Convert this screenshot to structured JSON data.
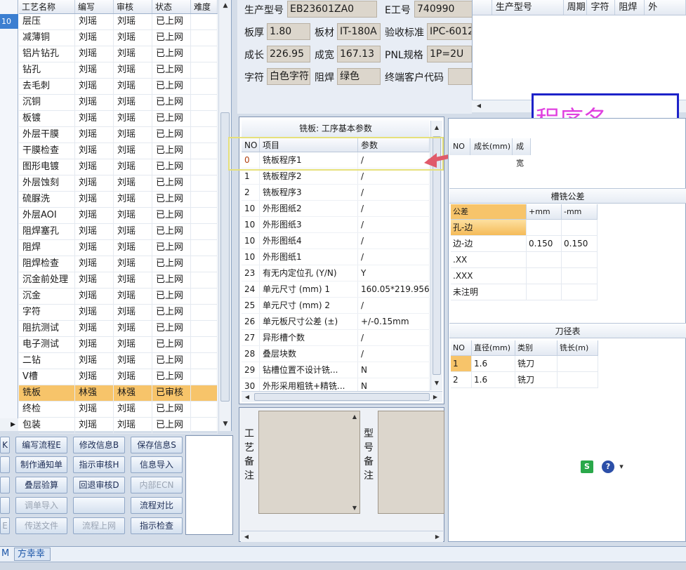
{
  "process_grid": {
    "selected_row_marker": "10",
    "headers": [
      "工艺名称",
      "编写",
      "审核",
      "状态",
      "难度"
    ],
    "rows": [
      [
        "层压",
        "刘瑶",
        "刘瑶",
        "已上网",
        ""
      ],
      [
        "减薄铜",
        "刘瑶",
        "刘瑶",
        "已上网",
        ""
      ],
      [
        "铝片钻孔",
        "刘瑶",
        "刘瑶",
        "已上网",
        ""
      ],
      [
        "钻孔",
        "刘瑶",
        "刘瑶",
        "已上网",
        ""
      ],
      [
        "去毛刺",
        "刘瑶",
        "刘瑶",
        "已上网",
        ""
      ],
      [
        "沉铜",
        "刘瑶",
        "刘瑶",
        "已上网",
        ""
      ],
      [
        "板镀",
        "刘瑶",
        "刘瑶",
        "已上网",
        ""
      ],
      [
        "外层干膜",
        "刘瑶",
        "刘瑶",
        "已上网",
        ""
      ],
      [
        "干膜检查",
        "刘瑶",
        "刘瑶",
        "已上网",
        ""
      ],
      [
        "图形电镀",
        "刘瑶",
        "刘瑶",
        "已上网",
        ""
      ],
      [
        "外层蚀刻",
        "刘瑶",
        "刘瑶",
        "已上网",
        ""
      ],
      [
        "硫脲洗",
        "刘瑶",
        "刘瑶",
        "已上网",
        ""
      ],
      [
        "外层AOI",
        "刘瑶",
        "刘瑶",
        "已上网",
        ""
      ],
      [
        "阻焊塞孔",
        "刘瑶",
        "刘瑶",
        "已上网",
        ""
      ],
      [
        "阻焊",
        "刘瑶",
        "刘瑶",
        "已上网",
        ""
      ],
      [
        "阻焊检查",
        "刘瑶",
        "刘瑶",
        "已上网",
        ""
      ],
      [
        "沉金前处理",
        "刘瑶",
        "刘瑶",
        "已上网",
        ""
      ],
      [
        "沉金",
        "刘瑶",
        "刘瑶",
        "已上网",
        ""
      ],
      [
        "字符",
        "刘瑶",
        "刘瑶",
        "已上网",
        ""
      ],
      [
        "阻抗测试",
        "刘瑶",
        "刘瑶",
        "已上网",
        ""
      ],
      [
        "电子测试",
        "刘瑶",
        "刘瑶",
        "已上网",
        ""
      ],
      [
        "二钻",
        "刘瑶",
        "刘瑶",
        "已上网",
        ""
      ],
      [
        "V槽",
        "刘瑶",
        "刘瑶",
        "已上网",
        ""
      ],
      [
        "铣板",
        "林强",
        "林强",
        "已审核",
        ""
      ],
      [
        "终检",
        "刘瑶",
        "刘瑶",
        "已上网",
        ""
      ],
      [
        "包装",
        "刘瑶",
        "刘瑶",
        "已上网",
        ""
      ]
    ],
    "highlight_row": 23
  },
  "buttons": {
    "edit_flow": "编写流程E",
    "modify_info": "修改信息B",
    "save_info": "保存信息S",
    "make_notice": "制作通知单",
    "guide_review": "指示审核H",
    "import_info": "信息导入",
    "lamination_check": "叠层验算",
    "back_review": "回退审核D",
    "internal_ecn": "内部ECN",
    "import_order": "调单导入",
    "blank": "",
    "flow_compare": "流程对比",
    "send_file": "传送文件",
    "flow_online": "流程上网",
    "guide_check": "指示检查",
    "edge_labels": [
      "K",
      "",
      "",
      "",
      "E"
    ]
  },
  "info": {
    "model_label": "生产型号",
    "model_value": "EB23601ZA0",
    "eno_label": "E工号",
    "eno_value": "740990",
    "thickness_label": "板厚",
    "thickness_value": "1.80",
    "material_label": "板材",
    "material_value": "IT-180A",
    "standard_label": "验收标准",
    "standard_value": "IPC-6012",
    "length_label": "成长",
    "length_value": "226.95",
    "width_label": "成宽",
    "width_value": "167.13",
    "pnl_label": "PNL规格",
    "pnl_value": "1P=2U",
    "char_label": "字符",
    "char_value": "白色字符",
    "mask_label": "阻焊",
    "mask_value": "绿色",
    "customer_label": "终端客户代码",
    "customer_value": ""
  },
  "right_top_grid": {
    "headers": [
      "生产型号",
      "周期",
      "字符",
      "阻焊",
      "外"
    ]
  },
  "annotation": {
    "text": "程序名"
  },
  "milling": {
    "title": "铣板: 工序基本参数",
    "headers": [
      "NO",
      "项目",
      "参数"
    ],
    "rows": [
      [
        "0",
        "铣板程序1",
        "/"
      ],
      [
        "1",
        "铣板程序2",
        "/"
      ],
      [
        "2",
        "铣板程序3",
        "/"
      ],
      [
        "10",
        "外形图纸2",
        "/"
      ],
      [
        "10",
        "外形图纸3",
        "/"
      ],
      [
        "10",
        "外形图纸4",
        "/"
      ],
      [
        "10",
        "外形图纸1",
        "/"
      ],
      [
        "23",
        "有无内定位孔 (Y/N)",
        "Y"
      ],
      [
        "24",
        "单元尺寸 (mm) 1",
        "160.05*219.956"
      ],
      [
        "25",
        "单元尺寸 (mm) 2",
        "/"
      ],
      [
        "26",
        "单元板尺寸公差 (±)",
        "+/-0.15mm"
      ],
      [
        "27",
        "异形槽个数",
        "/"
      ],
      [
        "28",
        "叠层块数",
        "/"
      ],
      [
        "29",
        "钻槽位置不设计铣...",
        "N"
      ],
      [
        "30",
        "外形采用粗铣+精铣...",
        "N"
      ]
    ]
  },
  "remarks": {
    "process_label": "工艺备注",
    "type_label": "型号备注"
  },
  "right_lower": {
    "grid1_headers": [
      "NO",
      "成长(mm)",
      "成宽"
    ],
    "tolerance": {
      "title": "槽铣公差",
      "headers": [
        "公差",
        "+mm",
        "-mm"
      ],
      "rows": [
        [
          "孔-边",
          "",
          ""
        ],
        [
          "边-边",
          "0.150",
          "0.150"
        ],
        [
          ".XX",
          "",
          ""
        ],
        [
          ".XXX",
          "",
          ""
        ],
        [
          "未注明",
          "",
          ""
        ]
      ]
    },
    "tools": {
      "title": "刀径表",
      "headers": [
        "NO",
        "直径(mm)",
        "类别",
        "铣长(m)"
      ],
      "rows": [
        [
          "1",
          "1.6",
          "铣刀",
          ""
        ],
        [
          "2",
          "1.6",
          "铣刀",
          ""
        ]
      ]
    }
  },
  "tray": {
    "s_icon": "S",
    "help_icon": "?",
    "more_icon": "▾"
  },
  "statusbar": {
    "left": "M",
    "user": "方幸幸"
  },
  "colors": {
    "highlight": "#f7c46a",
    "annotation_border": "#1d22c9",
    "annotation_text": "#e040e0",
    "arrow": "#e05a6a"
  }
}
